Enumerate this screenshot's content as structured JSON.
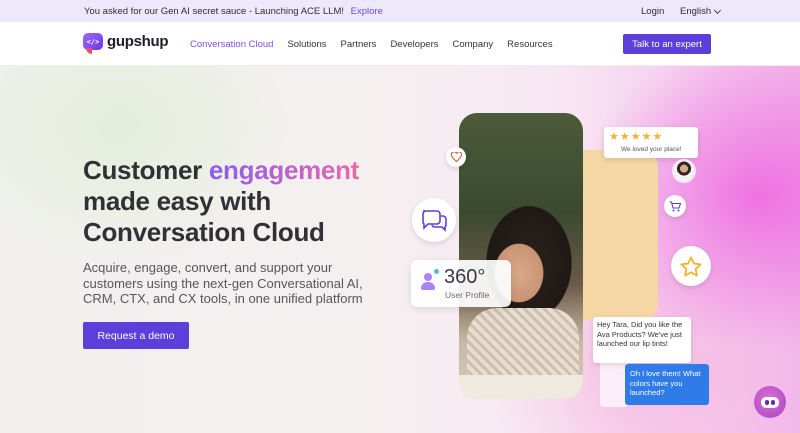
{
  "announcement": {
    "text": "You asked for our Gen AI secret sauce - Launching ACE LLM!",
    "link": "Explore"
  },
  "topbar": {
    "login": "Login",
    "language": "English"
  },
  "brand": {
    "logo_glyph": "</>",
    "name": "gupshup"
  },
  "nav": {
    "items": [
      "Conversation Cloud",
      "Solutions",
      "Partners",
      "Developers",
      "Company",
      "Resources"
    ],
    "active": "Conversation Cloud",
    "cta": "Talk to an expert"
  },
  "hero": {
    "headline_pre": "Customer ",
    "headline_accent": "engagement",
    "headline_line2": "made easy with",
    "headline_line3": "Conversation Cloud",
    "subtext": "Acquire, engage, convert, and support your customers using the next-gen Conversational AI, CRM, CTX, and CX tools, in one unified platform",
    "button": "Request a demo"
  },
  "visual": {
    "review_stars": "★★★★★",
    "review_text": "We loved your place!",
    "profile_value": "360°",
    "profile_label": "User Profile",
    "message_in": "Hey Tara, Did you like the Ava Products? We've just launched our lip tints!",
    "message_out": "Oh I love them! What colors have you launched?"
  },
  "icons": [
    "chevron-down-icon",
    "heart-icon",
    "chat-bubbles-icon",
    "cart-icon",
    "star-icon",
    "user-icon",
    "chatbot-icon"
  ],
  "colors": {
    "accent": "#5b3fdb",
    "active_nav": "#7b4fe6",
    "announce_bg": "#ede9fb",
    "message_out_bg": "#2f7be7"
  }
}
